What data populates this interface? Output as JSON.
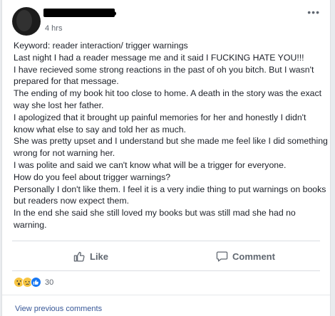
{
  "post": {
    "timestamp": "4 hrs",
    "more_label": "•••",
    "lines": [
      "Keyword: reader interaction/ trigger warnings",
      "Last night I had a reader message me and it said I FUCKING HATE YOU!!!",
      "I have recieved some strong reactions in the past of oh you bitch. But I wasn't prepared for that message.",
      "The ending of my book hit too close to home. A death in the story was the exact way she lost her father.",
      "I apologized that it brought up painful memories for her and honestly I didn't know what else to say and told her as much.",
      "She was pretty upset and I understand but she made me feel like I did something wrong for not warning her.",
      "I was polite and said we can't know what will be a trigger for everyone.",
      "How do you feel about trigger warnings?",
      "Personally I don't like them. I feel it is a very indie thing to put warnings on books but readers now expect them.",
      "In the end she said she still loved my books but was still mad she had no warning."
    ]
  },
  "actions": {
    "like_label": "Like",
    "comment_label": "Comment"
  },
  "reactions": {
    "icons": [
      "wow-icon",
      "sad-icon",
      "like-icon"
    ],
    "count": "30"
  },
  "comments": {
    "view_previous_label": "View previous comments"
  },
  "colors": {
    "link": "#385898",
    "like_blue": "#1877f2",
    "emoji_yellow": "#f7c542"
  }
}
